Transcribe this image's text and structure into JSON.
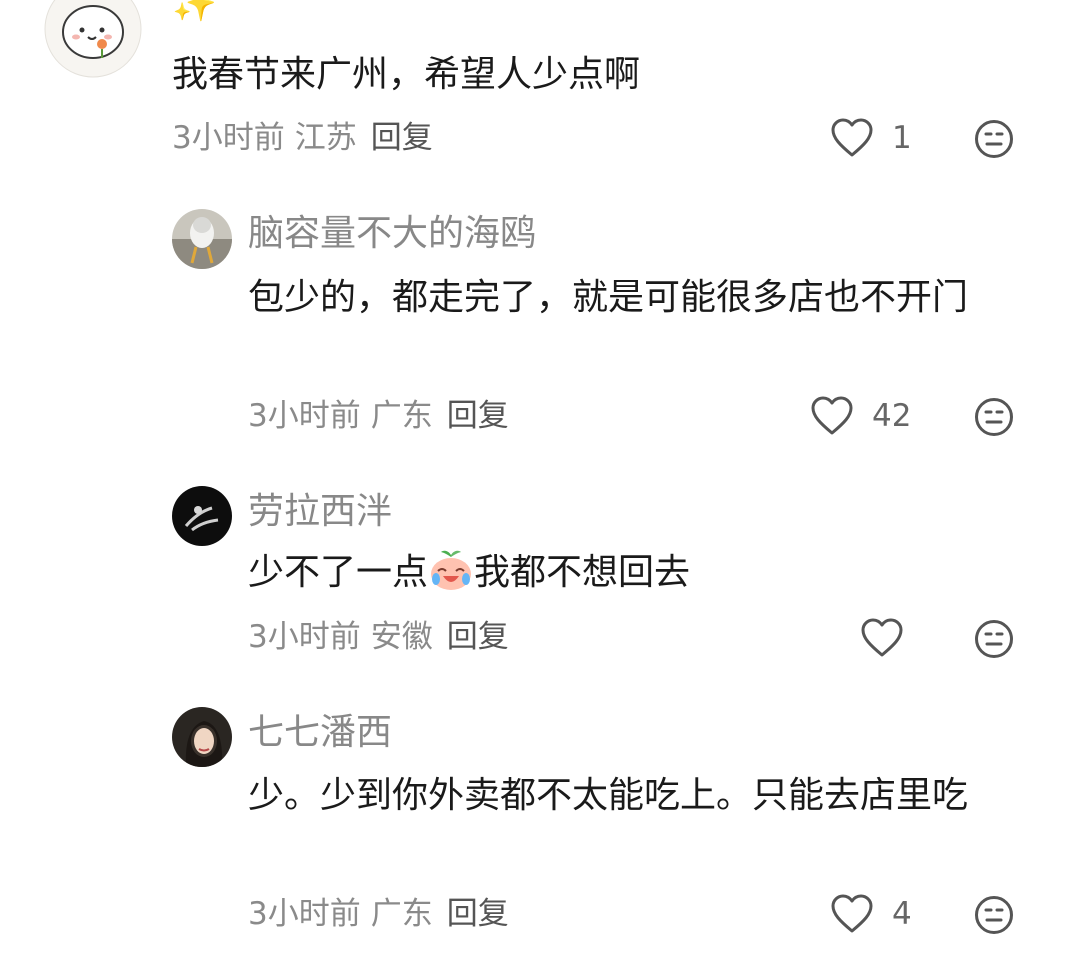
{
  "comments": [
    {
      "name": "",
      "name_suffix_glyph": "✨",
      "text": "我春节来广州，希望人少点啊",
      "time": "3小时前",
      "location": "江苏",
      "reply_label": "回复",
      "likes": "1"
    },
    {
      "name": "脑容量不大的海鸥",
      "text": "包少的，都走完了，就是可能很多店也不开门",
      "time": "3小时前",
      "location": "广东",
      "reply_label": "回复",
      "likes": "42"
    },
    {
      "name": "劳拉西泮",
      "text_before": "少不了一点",
      "text_after": "我都不想回去",
      "time": "3小时前",
      "location": "安徽",
      "reply_label": "回复",
      "likes": ""
    },
    {
      "name": "七七潘西",
      "text": "少。少到你外卖都不太能吃上。只能去店里吃",
      "time": "3小时前",
      "location": "广东",
      "reply_label": "回复",
      "likes": "4"
    }
  ],
  "icons": {
    "like": "heart-outline-icon",
    "emoji": "neutral-face-icon",
    "inline": "crying-laugh-peach-emoji"
  },
  "colors": {
    "name": "#888888",
    "text": "#1a1a1a",
    "meta": "#8a8a8a",
    "icon": "#555555"
  }
}
